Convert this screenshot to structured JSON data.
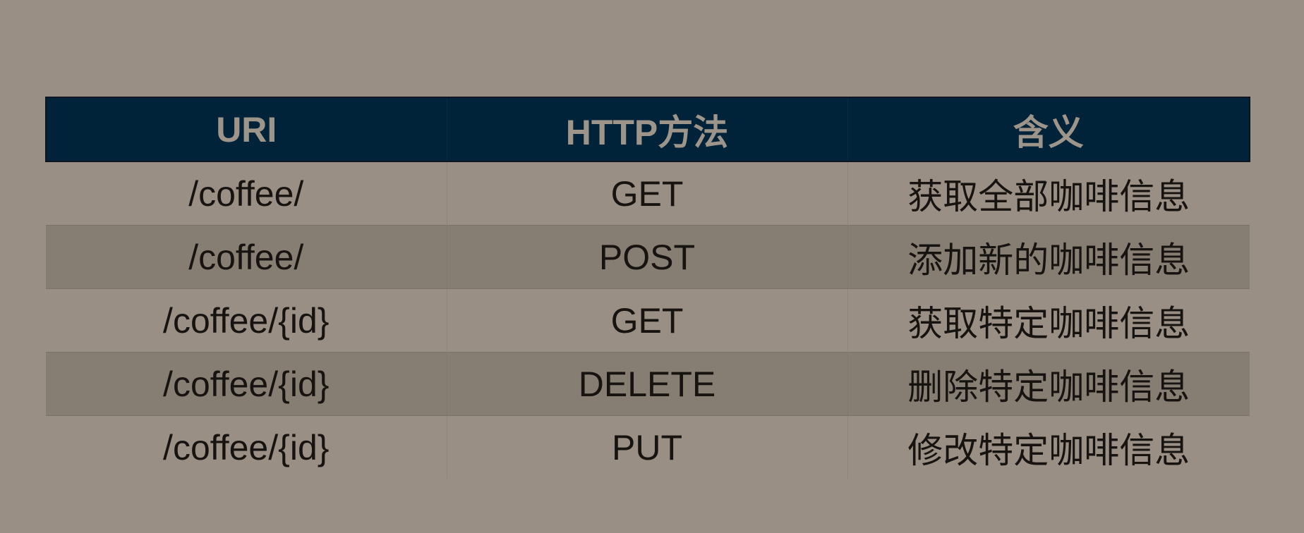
{
  "table": {
    "headers": [
      "URI",
      "HTTP方法",
      "含义"
    ],
    "rows": [
      {
        "uri": "/coffee/",
        "method": "GET",
        "meaning": "获取全部咖啡信息"
      },
      {
        "uri": "/coffee/",
        "method": "POST",
        "meaning": "添加新的咖啡信息"
      },
      {
        "uri": "/coffee/{id}",
        "method": "GET",
        "meaning": "获取特定咖啡信息"
      },
      {
        "uri": "/coffee/{id}",
        "method": "DELETE",
        "meaning": "删除特定咖啡信息"
      },
      {
        "uri": "/coffee/{id}",
        "method": "PUT",
        "meaning": "修改特定咖啡信息"
      }
    ]
  },
  "colors": {
    "background": "#998f84",
    "header_bg": "#00233a",
    "header_text": "#9d948a",
    "alt_row_bg": "#867d73",
    "body_text": "#161310"
  }
}
